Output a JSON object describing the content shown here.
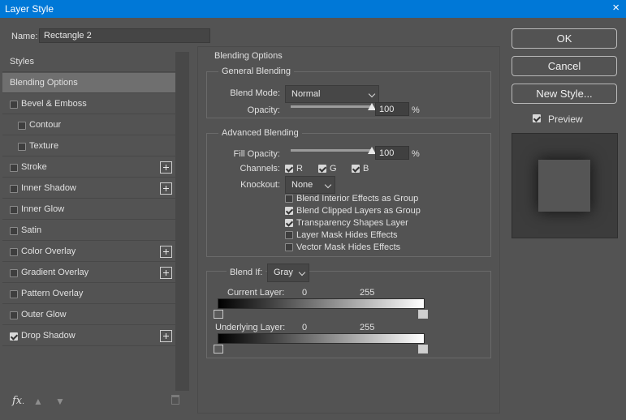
{
  "window": {
    "title": "Layer Style",
    "close_icon": "×"
  },
  "name_field": {
    "label": "Name:",
    "value": "Rectangle 2"
  },
  "sidebar": {
    "items": [
      {
        "label": "Styles",
        "type": "header"
      },
      {
        "label": "Blending Options",
        "type": "item",
        "selected": true
      },
      {
        "label": "Bevel & Emboss",
        "type": "check",
        "checked": false
      },
      {
        "label": "Contour",
        "type": "subcheck",
        "checked": false
      },
      {
        "label": "Texture",
        "type": "subcheck",
        "checked": false
      },
      {
        "label": "Stroke",
        "type": "check",
        "checked": false,
        "plus": true
      },
      {
        "label": "Inner Shadow",
        "type": "check",
        "checked": false,
        "plus": true
      },
      {
        "label": "Inner Glow",
        "type": "check",
        "checked": false
      },
      {
        "label": "Satin",
        "type": "check",
        "checked": false
      },
      {
        "label": "Color Overlay",
        "type": "check",
        "checked": false,
        "plus": true
      },
      {
        "label": "Gradient Overlay",
        "type": "check",
        "checked": false,
        "plus": true
      },
      {
        "label": "Pattern Overlay",
        "type": "check",
        "checked": false
      },
      {
        "label": "Outer Glow",
        "type": "check",
        "checked": false
      },
      {
        "label": "Drop Shadow",
        "type": "check",
        "checked": true,
        "plus": true
      }
    ],
    "fx_label": "fx",
    "fx_suffix": "."
  },
  "blending": {
    "section_title": "Blending Options",
    "general": {
      "title": "General Blending",
      "blend_mode_label": "Blend Mode:",
      "blend_mode": "Normal",
      "opacity_label": "Opacity:",
      "opacity": "100",
      "opacity_level": 100,
      "pct": "%"
    },
    "advanced": {
      "title": "Advanced Blending",
      "fill_opacity_label": "Fill Opacity:",
      "fill_opacity": "100",
      "fill_opacity_level": 100,
      "pct": "%",
      "channels_label": "Channels:",
      "channels": [
        {
          "label": "R",
          "checked": true
        },
        {
          "label": "G",
          "checked": true
        },
        {
          "label": "B",
          "checked": true
        }
      ],
      "knockout_label": "Knockout:",
      "knockout": "None",
      "options": [
        {
          "label": "Blend Interior Effects as Group",
          "checked": false
        },
        {
          "label": "Blend Clipped Layers as Group",
          "checked": true
        },
        {
          "label": "Transparency Shapes Layer",
          "checked": true
        },
        {
          "label": "Layer Mask Hides Effects",
          "checked": false
        },
        {
          "label": "Vector Mask Hides Effects",
          "checked": false
        }
      ]
    },
    "blend_if": {
      "label": "Blend If:",
      "value": "Gray",
      "current_layer": {
        "label": "Current Layer:",
        "low": "0",
        "high": "255"
      },
      "underlying_layer": {
        "label": "Underlying Layer:",
        "low": "0",
        "high": "255"
      }
    }
  },
  "buttons": {
    "ok": "OK",
    "cancel": "Cancel",
    "new_style": "New Style..."
  },
  "preview": {
    "label": "Preview",
    "checked": true
  }
}
